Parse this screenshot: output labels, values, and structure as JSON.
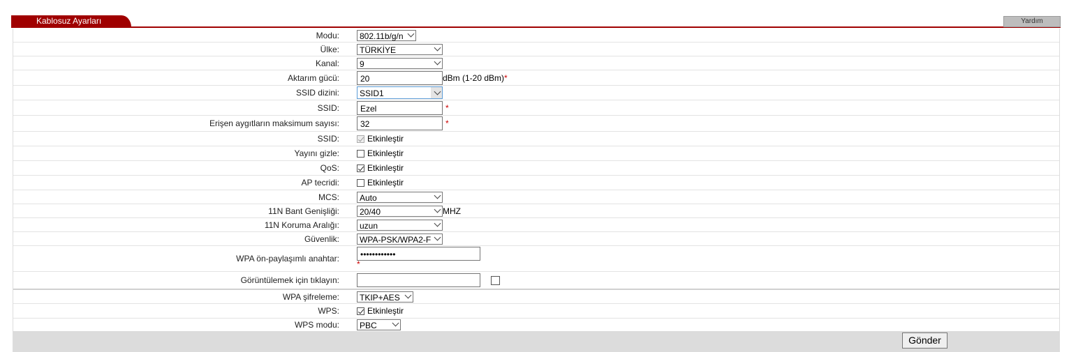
{
  "header": {
    "tab_title": "Kablosuz Ayarları",
    "help_label": "Yardım"
  },
  "form": {
    "mode": {
      "label": "Modu:",
      "value": "802.11b/g/n"
    },
    "country": {
      "label": "Ülke:",
      "value": "TÜRKİYE"
    },
    "channel": {
      "label": "Kanal:",
      "value": "9"
    },
    "tx_power": {
      "label": "Aktarım gücü:",
      "value": "20",
      "suffix": "dBm (1-20 dBm)"
    },
    "ssid_index": {
      "label": "SSID dizini:",
      "value": "SSID1"
    },
    "ssid": {
      "label": "SSID:",
      "value": "Ezel"
    },
    "max_devices": {
      "label": "Erişen aygıtların maksimum sayısı:",
      "value": "32"
    },
    "ssid_enable": {
      "label": "SSID:",
      "option": "Etkinleştir",
      "checked": true
    },
    "hide_broadcast": {
      "label": "Yayını gizle:",
      "option": "Etkinleştir",
      "checked": false
    },
    "qos": {
      "label": "QoS:",
      "option": "Etkinleştir",
      "checked": true
    },
    "ap_isolation": {
      "label": "AP tecridi:",
      "option": "Etkinleştir",
      "checked": false
    },
    "mcs": {
      "label": "MCS:",
      "value": "Auto"
    },
    "bandwidth": {
      "label": "11N Bant Genişliği:",
      "value": "20/40",
      "suffix": "MHZ"
    },
    "guard_interval": {
      "label": "11N Koruma Aralığı:",
      "value": "uzun"
    },
    "security": {
      "label": "Güvenlik:",
      "value": "WPA-PSK/WPA2-F"
    },
    "wpa_key": {
      "label": "WPA ön-paylaşımlı anahtar:",
      "value": "••••••••••••"
    },
    "show_key": {
      "label": "Görüntülemek için tıklayın:",
      "value": "",
      "checked": false
    },
    "wpa_encryption": {
      "label": "WPA şifreleme:",
      "value": "TKIP+AES"
    },
    "wps": {
      "label": "WPS:",
      "option": "Etkinleştir",
      "checked": true
    },
    "wps_mode": {
      "label": "WPS modu:",
      "value": "PBC"
    },
    "required_mark": "*",
    "submit_label": "Gönder"
  },
  "colors": {
    "accent": "#a00000",
    "footer_bg": "#dcdcdc"
  }
}
